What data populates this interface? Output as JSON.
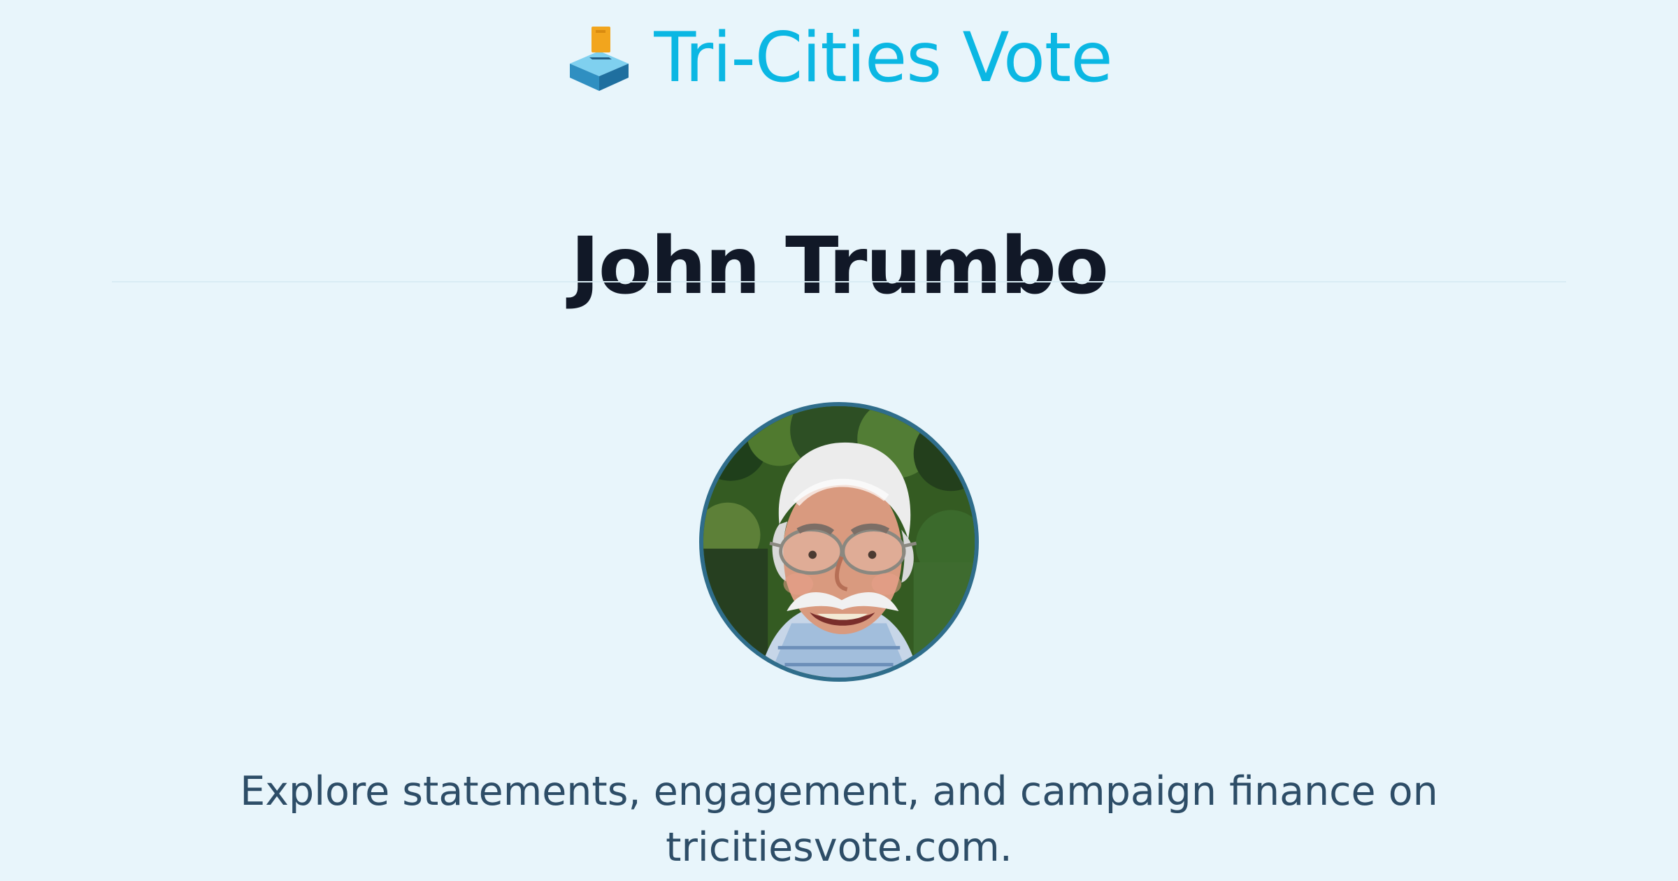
{
  "site": {
    "name": "Tri-Cities Vote",
    "icon": "ballot-box-icon",
    "accent_color": "#0bb7e3"
  },
  "candidate": {
    "name": "John Trumbo",
    "photo": "candidate-photo"
  },
  "description": "Explore statements, engagement, and campaign finance on tricitiesvote.com.",
  "colors": {
    "background": "#e8f5fb",
    "heading": "#111827",
    "body_text": "#2d4d67",
    "avatar_border": "#2f6d8b"
  }
}
